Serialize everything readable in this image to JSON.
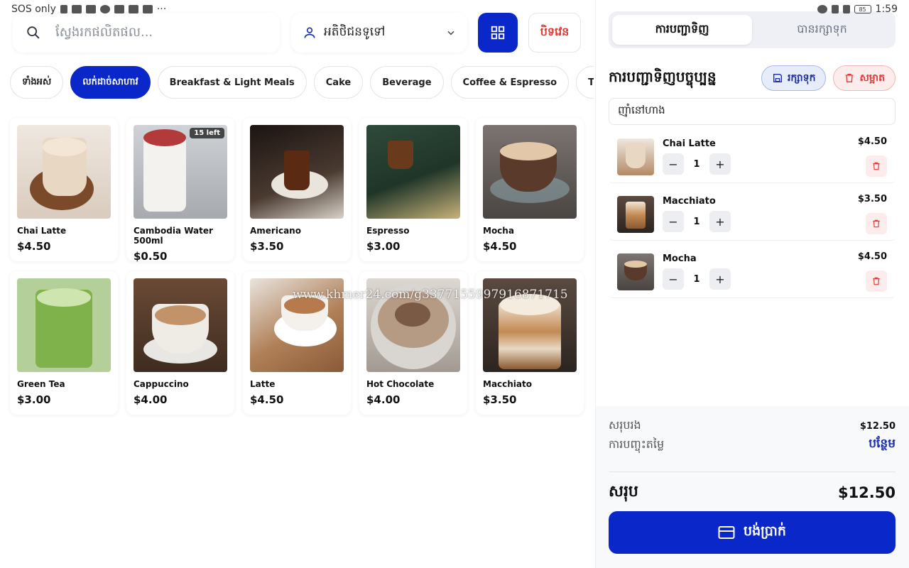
{
  "status_bar": {
    "carrier": "SOS only",
    "time": "1:59",
    "battery": "85"
  },
  "search": {
    "placeholder": "ស្វែងរកផលិតផល..."
  },
  "customer": {
    "value": "អតិថិជនទូទៅ"
  },
  "header": {
    "close_label": "បិទវេន"
  },
  "categories": [
    {
      "label": "ទាំងអស់"
    },
    {
      "label": "លក់ដាច់សាហាវ"
    },
    {
      "label": "Breakfast & Light Meals"
    },
    {
      "label": "Cake"
    },
    {
      "label": "Beverage"
    },
    {
      "label": "Coffee & Espresso"
    },
    {
      "label": "Tea & Other"
    }
  ],
  "products": [
    {
      "name": "Chai Latte",
      "price": "$4.50",
      "badge": ""
    },
    {
      "name": "Cambodia Water 500ml",
      "price": "$0.50",
      "badge": "15 left"
    },
    {
      "name": "Americano",
      "price": "$3.50",
      "badge": ""
    },
    {
      "name": "Espresso",
      "price": "$3.00",
      "badge": ""
    },
    {
      "name": "Mocha",
      "price": "$4.50",
      "badge": ""
    },
    {
      "name": "Green Tea",
      "price": "$3.00",
      "badge": ""
    },
    {
      "name": "Cappuccino",
      "price": "$4.00",
      "badge": ""
    },
    {
      "name": "Latte",
      "price": "$4.50",
      "badge": ""
    },
    {
      "name": "Hot Chocolate",
      "price": "$4.00",
      "badge": ""
    },
    {
      "name": "Macchiato",
      "price": "$3.50",
      "badge": ""
    }
  ],
  "watermark": "www.khmer24.com/g3377155997916871715",
  "right_panel": {
    "tabs": [
      {
        "label": "ការបញ្ជាទិញ"
      },
      {
        "label": "បានរក្សាទុក"
      }
    ],
    "title": "ការបញ្ជាទិញបច្ចុប្បន្ន",
    "save_label": "រក្សាទុក",
    "clear_label": "សម្អាត",
    "order_type": "ញ៉ាំនៅហាង",
    "cart": [
      {
        "name": "Chai Latte",
        "qty": "1",
        "price": "$4.50"
      },
      {
        "name": "Macchiato",
        "qty": "1",
        "price": "$3.50"
      },
      {
        "name": "Mocha",
        "qty": "1",
        "price": "$4.50"
      }
    ],
    "summary": {
      "subtotal_label": "សរុបរង",
      "subtotal": "$12.50",
      "discount_label": "ការបញ្ចុះតម្លៃ",
      "discount_action": "បន្ថែម",
      "total_label": "សរុប",
      "total": "$12.50"
    },
    "pay_label": "បង់ប្រាក់"
  },
  "colors": {
    "primary": "#0a28c9",
    "danger": "#e53935"
  }
}
